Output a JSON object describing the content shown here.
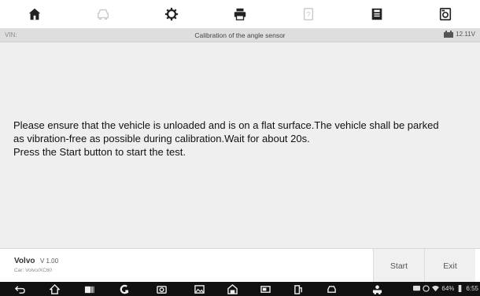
{
  "toolbar": {
    "icons": [
      "home-icon",
      "car-icon",
      "gear-icon",
      "print-icon",
      "help-icon",
      "save-icon",
      "camera-icon"
    ]
  },
  "status": {
    "vin_label": "VIN:",
    "title": "Calibration of the angle sensor",
    "voltage": "12.11V"
  },
  "message": {
    "text": "Please ensure that the vehicle is unloaded and is on a flat surface.The vehicle shall be parked\nas vibration-free as possible during calibration.Wait for about 20s.\nPress the Start button to start the test."
  },
  "vehicle": {
    "make": "Volvo",
    "version": "V 1.00",
    "car": "Car: Volvo/XC60"
  },
  "actions": {
    "start_label": "Start",
    "exit_label": "Exit"
  },
  "system": {
    "battery": "64%",
    "time": "6:55"
  }
}
